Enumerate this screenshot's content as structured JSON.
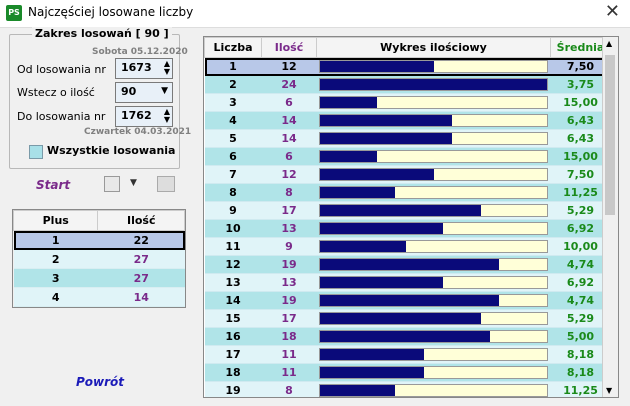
{
  "window": {
    "title": "Najczęściej losowane liczby",
    "app_icon": "PS"
  },
  "left": {
    "group_title": "Zakres losowań  [ 90 ]",
    "date_from": "Sobota 05.12.2020",
    "od_label": "Od losowania nr",
    "od_value": "1673",
    "wstecz_label": "Wstecz o ilość",
    "wstecz_value": "90",
    "do_label": "Do losowania nr",
    "do_value": "1762",
    "date_to": "Czwartek 04.03.2021",
    "all_label": "Wszystkie losowania",
    "start_label": "Start",
    "back_label": "Powrót"
  },
  "plus_table": {
    "headers": [
      "Plus",
      "Ilość"
    ],
    "rows": [
      {
        "plus": "1",
        "ilosc": "22"
      },
      {
        "plus": "2",
        "ilosc": "27"
      },
      {
        "plus": "3",
        "ilosc": "27"
      },
      {
        "plus": "4",
        "ilosc": "14"
      }
    ]
  },
  "main_table": {
    "headers": [
      "Liczba",
      "Ilość",
      "Wykres ilościowy",
      "Średnia"
    ],
    "rows": [
      {
        "liczba": "1",
        "ilosc": "12",
        "srednia": "7,50",
        "fill": 0.5
      },
      {
        "liczba": "2",
        "ilosc": "24",
        "srednia": "3,75",
        "fill": 1.0
      },
      {
        "liczba": "3",
        "ilosc": "6",
        "srednia": "15,00",
        "fill": 0.25
      },
      {
        "liczba": "4",
        "ilosc": "14",
        "srednia": "6,43",
        "fill": 0.58
      },
      {
        "liczba": "5",
        "ilosc": "14",
        "srednia": "6,43",
        "fill": 0.58
      },
      {
        "liczba": "6",
        "ilosc": "6",
        "srednia": "15,00",
        "fill": 0.25
      },
      {
        "liczba": "7",
        "ilosc": "12",
        "srednia": "7,50",
        "fill": 0.5
      },
      {
        "liczba": "8",
        "ilosc": "8",
        "srednia": "11,25",
        "fill": 0.33
      },
      {
        "liczba": "9",
        "ilosc": "17",
        "srednia": "5,29",
        "fill": 0.71
      },
      {
        "liczba": "10",
        "ilosc": "13",
        "srednia": "6,92",
        "fill": 0.54
      },
      {
        "liczba": "11",
        "ilosc": "9",
        "srednia": "10,00",
        "fill": 0.38
      },
      {
        "liczba": "12",
        "ilosc": "19",
        "srednia": "4,74",
        "fill": 0.79
      },
      {
        "liczba": "13",
        "ilosc": "13",
        "srednia": "6,92",
        "fill": 0.54
      },
      {
        "liczba": "14",
        "ilosc": "19",
        "srednia": "4,74",
        "fill": 0.79
      },
      {
        "liczba": "15",
        "ilosc": "17",
        "srednia": "5,29",
        "fill": 0.71
      },
      {
        "liczba": "16",
        "ilosc": "18",
        "srednia": "5,00",
        "fill": 0.75
      },
      {
        "liczba": "17",
        "ilosc": "11",
        "srednia": "8,18",
        "fill": 0.46
      },
      {
        "liczba": "18",
        "ilosc": "11",
        "srednia": "8,18",
        "fill": 0.46
      },
      {
        "liczba": "19",
        "ilosc": "8",
        "srednia": "11,25",
        "fill": 0.33
      }
    ]
  },
  "colors": {
    "selected_row": "#b8c8e8",
    "row_light": "#e0f4f8",
    "row_teal": "#b0e4e8",
    "ilosc_text": "#7a2a8a",
    "srednia_text": "#1a8a1a",
    "bar_fill": "#0a0a7a",
    "bar_bg": "#ffffd8"
  },
  "icons": {
    "close": "close-icon",
    "save": "save-icon",
    "print": "printer-icon"
  }
}
